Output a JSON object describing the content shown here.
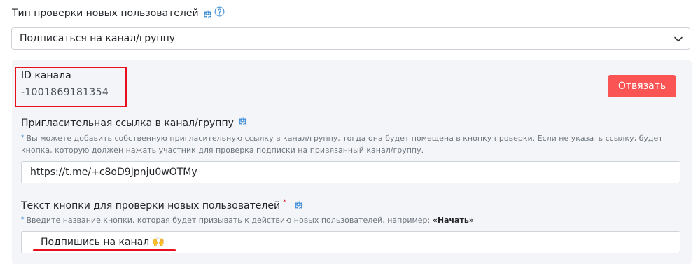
{
  "verification": {
    "label": "Тип проверки новых пользователей",
    "selected_option": "Подписаться на канал/группу"
  },
  "channel": {
    "id_label": "ID канала",
    "id_value": "-1001869181354",
    "unbind_label": "Отвязать"
  },
  "invite_link": {
    "label": "Пригласительная ссылка в канал/группу",
    "hint": "Вы можете добавить собственную пригласительную ссылку в канал/группу, тогда она будет помещена в кнопку проверки. Если не указать ссылку, будет кнопка, которую должен нажать участник для проверка подписки на привязанный канал/группу.",
    "value": "https://t.me/+c8oD9Jpnju0wOTMy"
  },
  "button_text": {
    "label": "Текст кнопки для проверки новых пользователей",
    "required_mark": "*",
    "hint": "Введите название кнопки, которая будет призывать к действию новых пользователей, например:",
    "hint_example": "«Начать»",
    "value": "Подпишись на канал 🙌"
  },
  "colors": {
    "accent": "#3f8fd6",
    "danger_button": "#fa5454",
    "annotation_red": "#e8101b",
    "panel_bg": "#f4f5f9"
  },
  "icons": {
    "settings": "gear-icon",
    "help": "question-circle-icon",
    "dropdown": "chevron-down-icon"
  }
}
